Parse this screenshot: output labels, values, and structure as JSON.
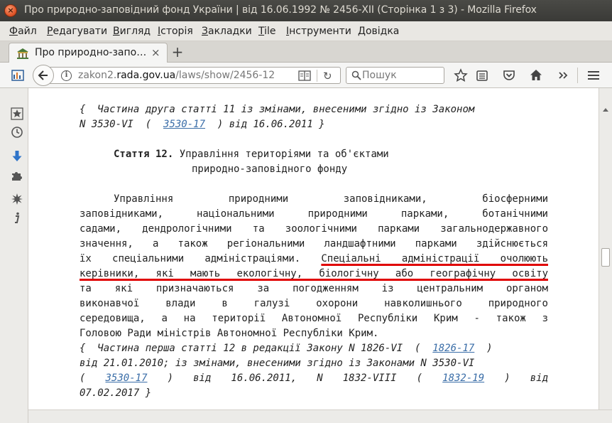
{
  "window": {
    "title": "Про природно-заповідний фонд України | від 16.06.1992 № 2456-XII (Сторінка 1 з 3) - Mozilla Firefox"
  },
  "menu": [
    {
      "label": "Файл",
      "u": "Ф",
      "rest": "айл"
    },
    {
      "label": "Редагувати",
      "u": "Р",
      "rest": "едагувати"
    },
    {
      "label": "Вигляд",
      "u": "В",
      "rest": "игляд"
    },
    {
      "label": "Історія",
      "u": "І",
      "rest": "сторія"
    },
    {
      "label": "Закладки",
      "u": "З",
      "rest": "акладки"
    },
    {
      "label": "Tile",
      "u": "T",
      "rest": "ile"
    },
    {
      "label": "Інструменти",
      "u": "І",
      "rest": "нструменти"
    },
    {
      "label": "Довідка",
      "u": "Д",
      "rest": "овідка"
    }
  ],
  "tab": {
    "title": "Про природно-запо…",
    "close": "×",
    "new_tab": "+"
  },
  "url": {
    "domain_prefix": "zakon2.",
    "domain_main": "rada.gov.ua",
    "path": "/laws/show/2456-12"
  },
  "search": {
    "placeholder": "Пошук"
  },
  "doc": {
    "note1_l1": "{  Частина друга статті 11 із змінами, внесеними згідно із Законом",
    "note1_l2a": "N 3530-VI  (  ",
    "note1_link": "3530-17",
    "note1_l2b": "  ) від 16.06.2011 }",
    "article_label": "Стаття 12.",
    "article_title_l1": " Управління територіями та об'єктами",
    "article_title_l2": "природно-заповідного фонду",
    "p1": "Управління природними заповідниками, біосферними",
    "p2": "заповідниками, національними природними парками, ботанічними",
    "p3": "садами, дендрологічними та зоологічними парками загальнодержавного",
    "p4": "значення, а також регіональними ландшафтними парками здійснюється",
    "p5a": "їх спеціальними адміністраціями. ",
    "p5b": "Спеціальні адміністрації очолюють",
    "p6": "керівники, які мають екологічну, біологічну або географічну освіту",
    "p7": "та які призначаються за погодженням із центральним органом",
    "p8": "виконавчої влади в галузі охорони навколишнього природного",
    "p9": "середовища, а на території Автономної Республіки Крим - також з",
    "p10": "Головою Ради міністрів Автономної Республіки Крим.",
    "n2_l1a": "{  Частина перша статті 12 в редакції Закону N 1826-VI  (  ",
    "n2_link1": "1826-17",
    "n2_l1b": "  )",
    "n2_l2": "від 21.01.2010; із змінами, внесеними згідно із Законами N 3530-VI",
    "n2_l3a": "(  ",
    "n2_link2": "3530-17",
    "n2_l3b": "  ) від 16.06.2011, N 1832-VIII  (  ",
    "n2_link3": "1832-19",
    "n2_l3c": "  ) від",
    "n2_l4": "07.02.2017 }"
  }
}
